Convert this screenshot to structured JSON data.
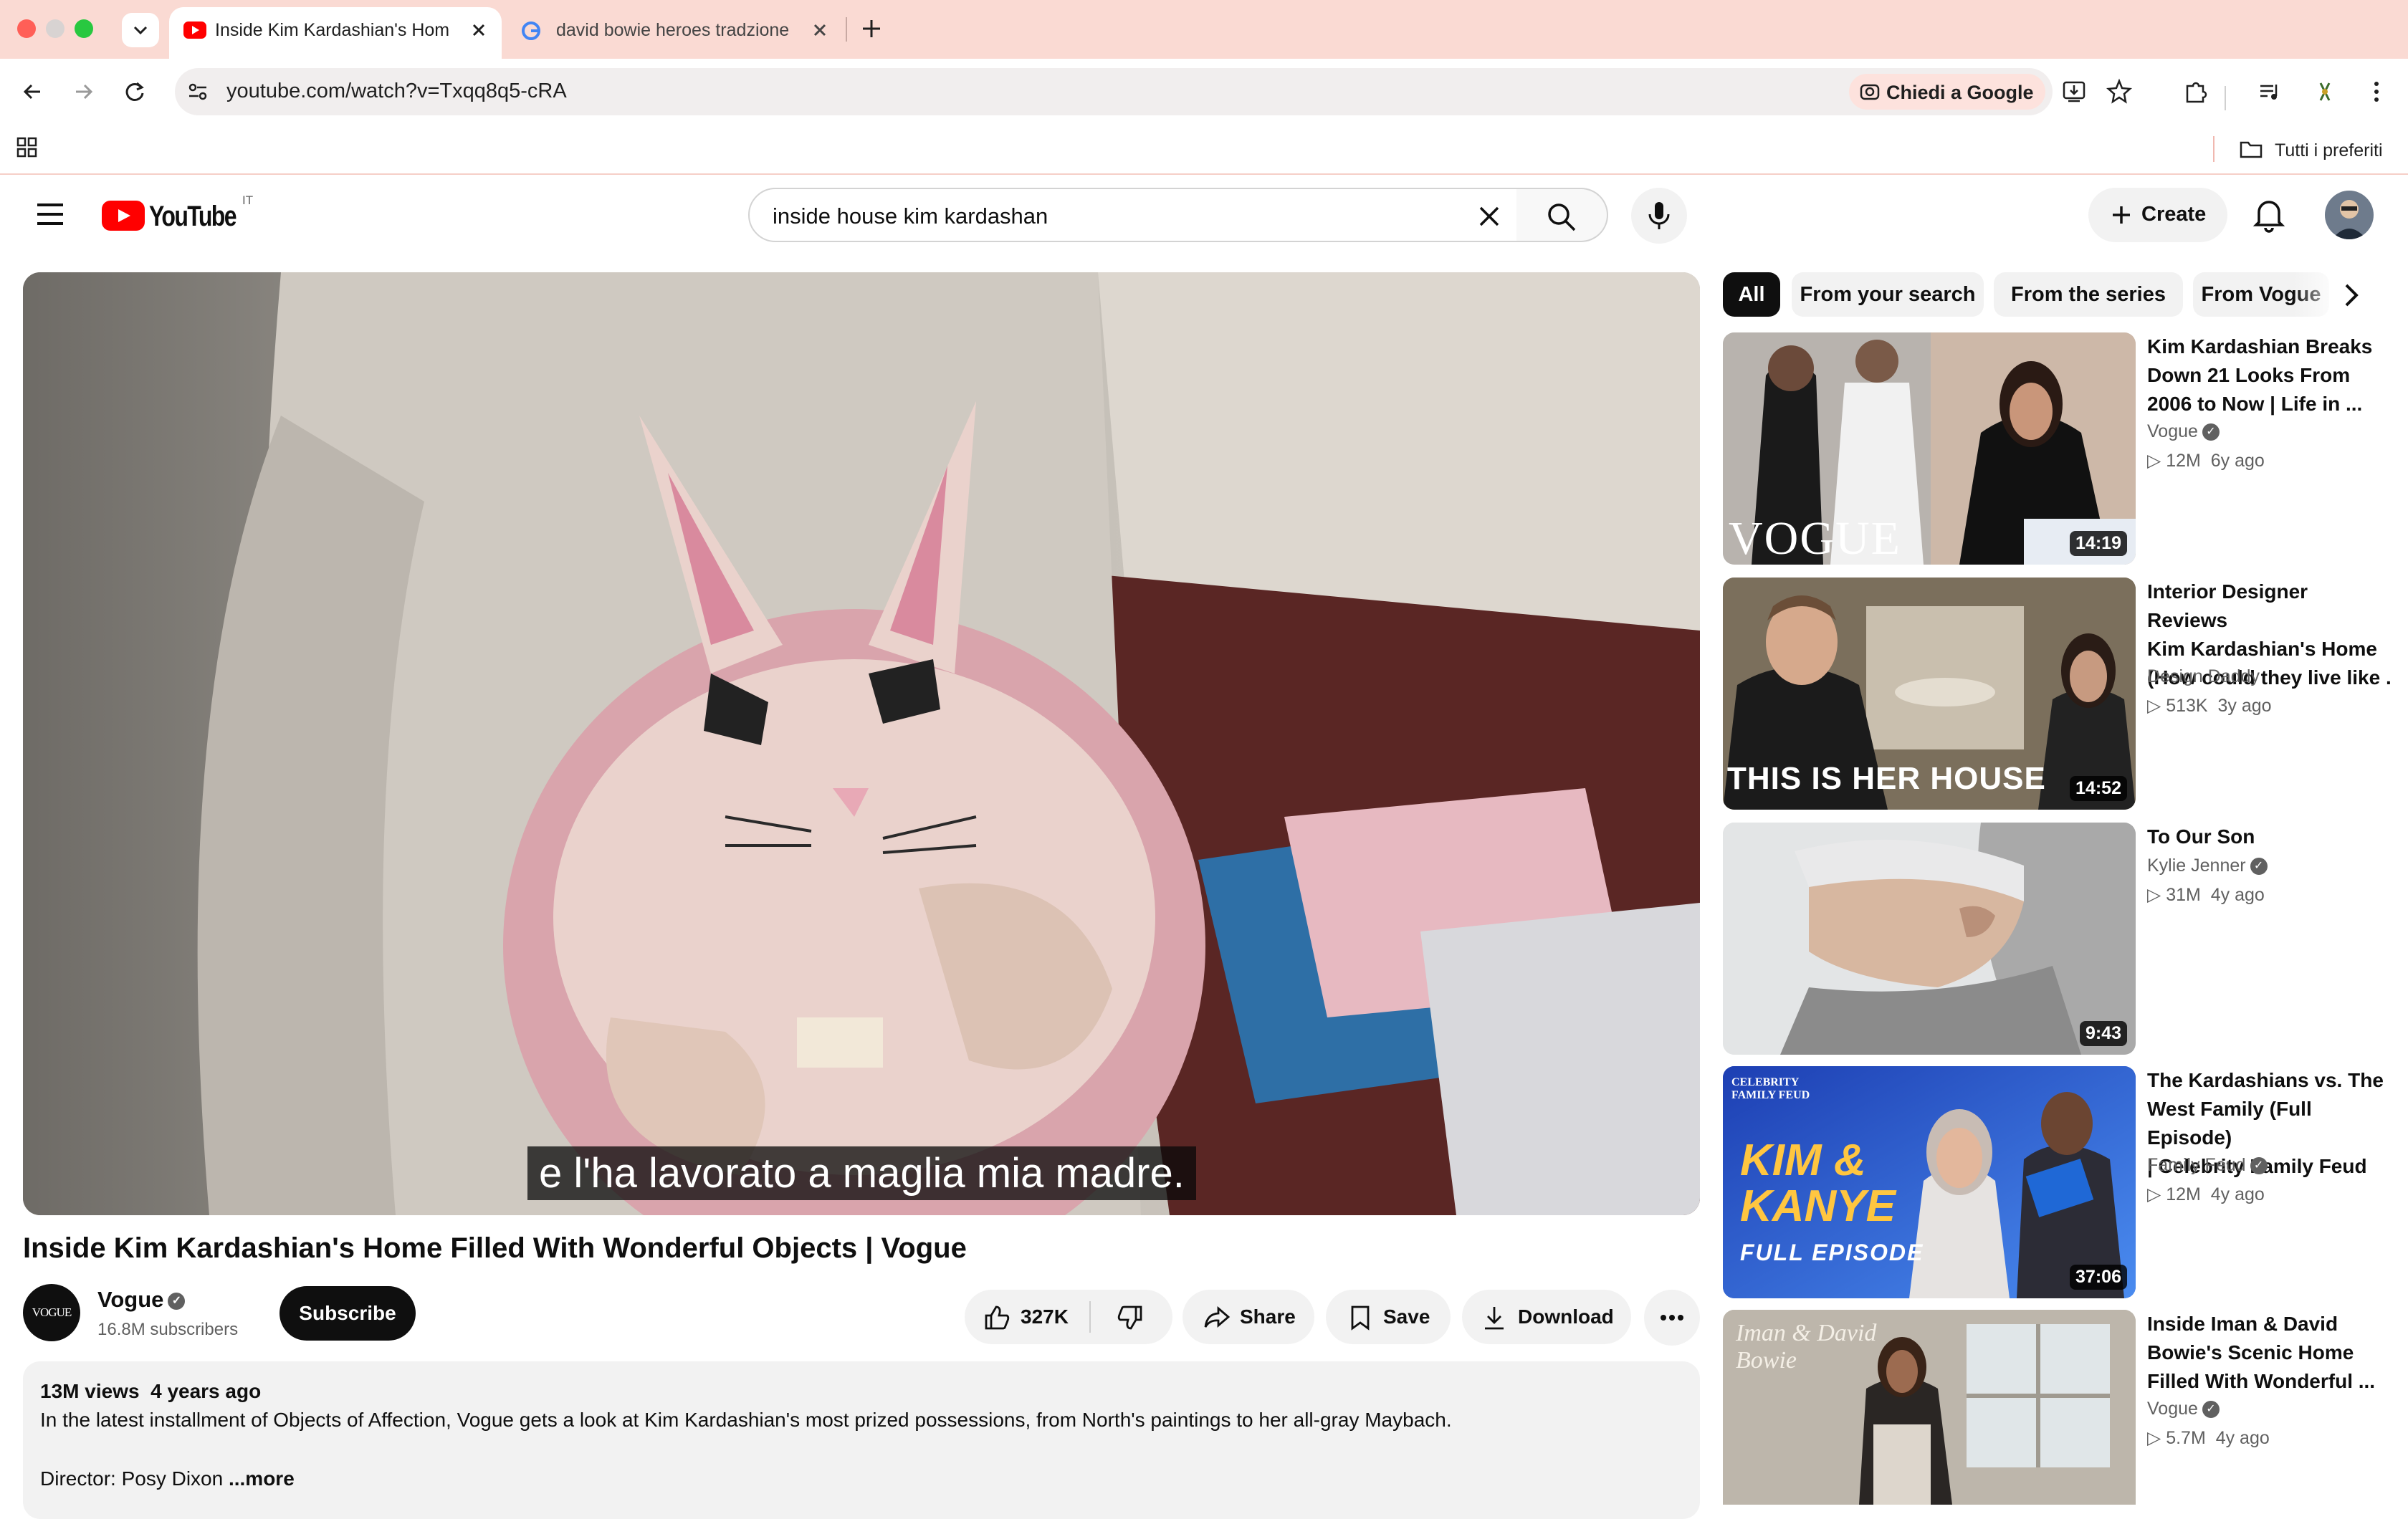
{
  "browser": {
    "tabs": [
      {
        "title": "Inside Kim Kardashian's Home"
      },
      {
        "title": "david bowie heroes tradzione"
      }
    ],
    "url": "youtube.com/watch?v=Txqq8q5-cRA",
    "ask_google": "Chiedi a Google",
    "bookmarks_folder": "Tutti i preferiti"
  },
  "youtube": {
    "logo_text": "YouTube",
    "region": "IT",
    "search_value": "inside house kim kardashan",
    "create_label": "Create"
  },
  "video": {
    "caption": "e l'ha lavorato a maglia mia madre.",
    "title": "Inside Kim Kardashian's Home Filled With Wonderful Objects | Vogue",
    "channel": "Vogue",
    "channel_avatar": "VOGUE",
    "subscribers": "16.8M subscribers",
    "subscribe_label": "Subscribe",
    "likes": "327K",
    "share_label": "Share",
    "save_label": "Save",
    "download_label": "Download",
    "views": "13M views",
    "age": "4 years ago",
    "description": "In the latest installment of Objects of Affection, Vogue gets a look at Kim Kardashian's most prized possessions, from North's paintings to her all-gray Maybach.",
    "director": "Director: Posy Dixon",
    "more_label": "...more"
  },
  "filters": [
    "All",
    "From your search",
    "From the series",
    "From Vogue"
  ],
  "recommendations": [
    {
      "title_lines": [
        "Kim Kardashian Breaks",
        "Down 21 Looks From",
        "2006 to Now | Life in ..."
      ],
      "channel": "Vogue",
      "views": "12M",
      "age": "6y ago",
      "duration": "14:19",
      "thumb_text": "VOGUE"
    },
    {
      "title_lines": [
        "Interior Designer Reviews",
        "Kim Kardashian's Home",
        "(How could they live like ..."
      ],
      "channel": "Design Daddy",
      "views": "513K",
      "age": "3y ago",
      "duration": "14:52",
      "thumb_text": "THIS IS HER HOUSE"
    },
    {
      "title_lines": [
        "To Our Son"
      ],
      "channel": "Kylie Jenner",
      "views": "31M",
      "age": "4y ago",
      "duration": "9:43",
      "thumb_text": ""
    },
    {
      "title_lines": [
        "The Kardashians vs. The",
        "West Family (Full Episode)",
        "| Celebrity Family Feud"
      ],
      "channel": "Family Feud",
      "views": "12M",
      "age": "4y ago",
      "duration": "37:06",
      "thumb_text": "KIM & KANYE",
      "thumb_sub": "FULL EPISODE",
      "thumb_badge": "CELEBRITY FAMILY FEUD"
    },
    {
      "title_lines": [
        "Inside Iman & David",
        "Bowie's Scenic Home",
        "Filled With Wonderful ..."
      ],
      "channel": "Vogue",
      "views": "5.7M",
      "age": "4y ago",
      "duration": "",
      "thumb_text": "Iman & David Bowie"
    }
  ],
  "colors": {
    "brand_red": "#ff0000",
    "tab_bar": "#fadad3",
    "chip_active": "#0f0f0f"
  },
  "icons": [
    "back-icon",
    "forward-icon",
    "reload-icon",
    "site-settings-icon",
    "menu-icon",
    "search-icon",
    "clear-icon",
    "mic-icon",
    "bell-icon",
    "like-icon",
    "dislike-icon",
    "share-icon",
    "save-icon",
    "download-icon",
    "more-icon",
    "verified-icon",
    "chevron-right-icon"
  ]
}
